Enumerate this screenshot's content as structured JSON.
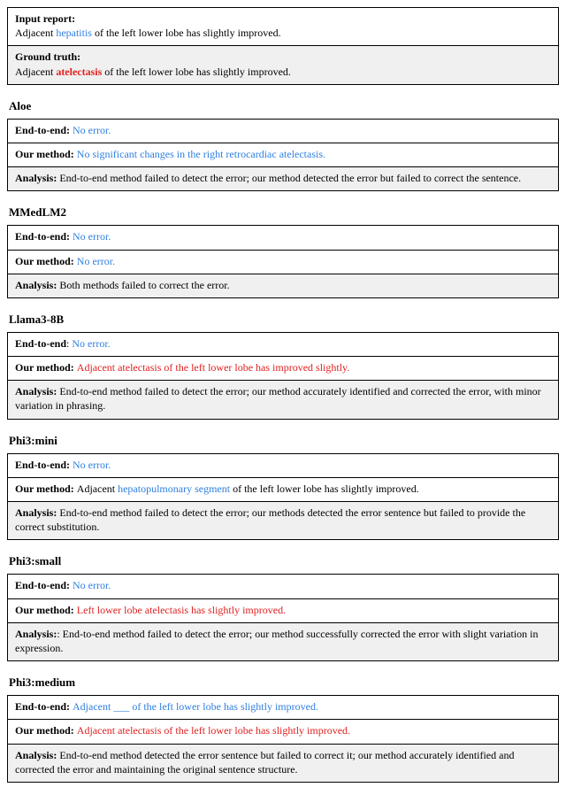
{
  "input": {
    "label": "Input report:",
    "pre": "Adjacent ",
    "term": "hepatitis",
    "post": " of the left lower lobe has slightly improved."
  },
  "truth": {
    "label": "Ground truth:",
    "pre": "Adjacent ",
    "term": "atelectasis",
    "post": " of the left lower lobe has slightly improved."
  },
  "labels": {
    "e2e": "End-to-end",
    "ours": "Our method",
    "analysis": "Analysis:"
  },
  "models": {
    "aloe": {
      "name": "Aloe",
      "e2e": "No error.",
      "ours": "No significant changes in the right retrocardiac atelectasis.",
      "analysis": " End-to-end method failed to detect the error; our method detected the error but failed to correct the sentence."
    },
    "mmedlm2": {
      "name": "MMedLM2",
      "e2e": "No error.",
      "ours": "No error.",
      "analysis": " Both methods failed to correct the error."
    },
    "llama3": {
      "name": "Llama3-8B",
      "e2e": "No error.",
      "ours": "Adjacent atelectasis of the left lower lobe has improved slightly.",
      "analysis": " End-to-end method failed to detect the error; our method accurately identified and corrected the error, with minor variation in phrasing."
    },
    "phi3mini": {
      "name": "Phi3:mini",
      "e2e": "No error.",
      "ours_pre": "Adjacent ",
      "ours_term": "hepatopulmonary segment",
      "ours_post": " of the left lower lobe has slightly improved.",
      "analysis": " End-to-end method failed to detect the error; our methods detected the error sentence but failed to provide the correct substitution."
    },
    "phi3small": {
      "name": "Phi3:small",
      "e2e": "No error.",
      "ours": "Left lower lobe atelectasis has slightly improved.",
      "analysis": ": End-to-end method failed to detect the error; our method successfully corrected the error with slight variation in expression."
    },
    "phi3medium": {
      "name": "Phi3:medium",
      "e2e": "Adjacent ___ of the left lower lobe has slightly improved.",
      "ours": "Adjacent atelectasis of the left lower lobe has slightly improved.",
      "analysis": " End-to-end method detected the error sentence but failed to correct it; our method accurately identified and corrected the error and maintaining the original sentence structure."
    }
  }
}
